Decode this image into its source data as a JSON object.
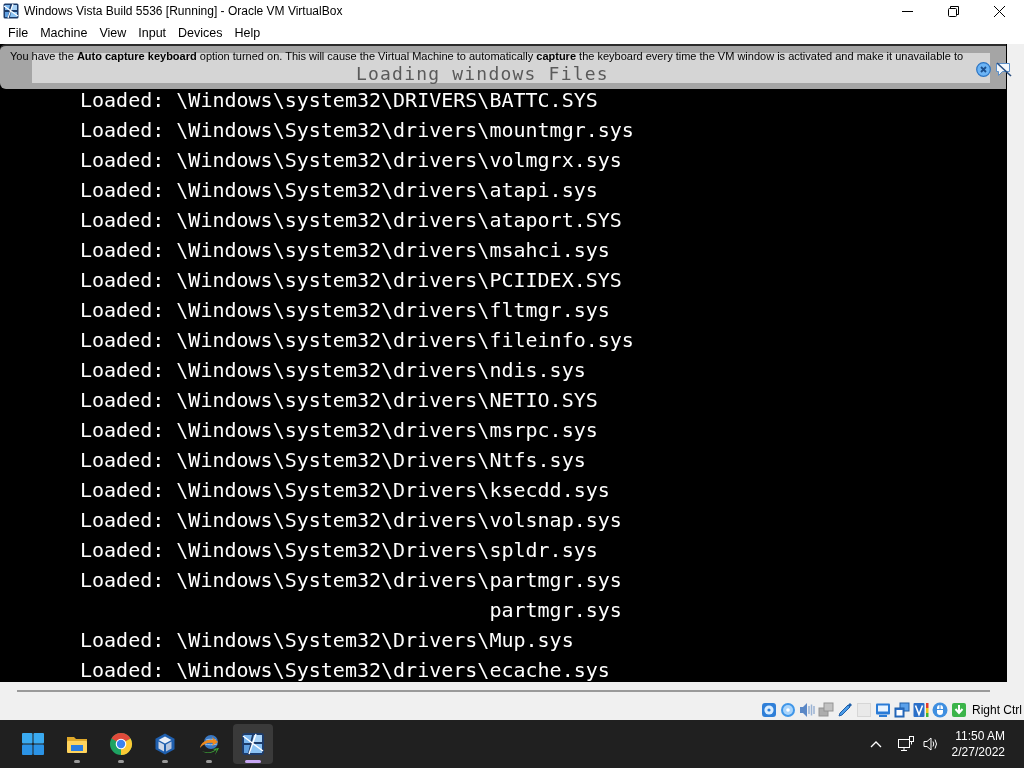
{
  "window": {
    "title": "Windows Vista Build 5536 [Running] - Oracle VM VirtualBox"
  },
  "menu": [
    "File",
    "Machine",
    "View",
    "Input",
    "Devices",
    "Help"
  ],
  "notification": {
    "text": "You have the **Auto capture keyboard** option turned on. This will cause the Virtual Machine to automatically **capture** the keyboard every time the VM window is activated and make it unavailable to"
  },
  "vm_screen": {
    "header": "Loading windows Files",
    "lines": [
      {
        "kind": "line",
        "text": "Loaded: \\Windows\\system32\\DRIVERS\\BATTC.SYS"
      },
      {
        "kind": "line",
        "text": "Loaded: \\Windows\\System32\\drivers\\mountmgr.sys"
      },
      {
        "kind": "line",
        "text": "Loaded: \\Windows\\System32\\drivers\\volmgrx.sys"
      },
      {
        "kind": "line",
        "text": "Loaded: \\Windows\\System32\\drivers\\atapi.sys"
      },
      {
        "kind": "line",
        "text": "Loaded: \\Windows\\system32\\drivers\\ataport.SYS"
      },
      {
        "kind": "line",
        "text": "Loaded: \\Windows\\system32\\drivers\\msahci.sys"
      },
      {
        "kind": "line",
        "text": "Loaded: \\Windows\\system32\\drivers\\PCIIDEX.SYS"
      },
      {
        "kind": "line",
        "text": "Loaded: \\Windows\\system32\\drivers\\fltmgr.sys"
      },
      {
        "kind": "line",
        "text": "Loaded: \\Windows\\system32\\drivers\\fileinfo.sys"
      },
      {
        "kind": "line",
        "text": "Loaded: \\Windows\\system32\\drivers\\ndis.sys"
      },
      {
        "kind": "line",
        "text": "Loaded: \\Windows\\system32\\drivers\\NETIO.SYS"
      },
      {
        "kind": "line",
        "text": "Loaded: \\Windows\\system32\\drivers\\msrpc.sys"
      },
      {
        "kind": "line",
        "text": "Loaded: \\Windows\\System32\\Drivers\\Ntfs.sys"
      },
      {
        "kind": "line",
        "text": "Loaded: \\Windows\\System32\\Drivers\\ksecdd.sys"
      },
      {
        "kind": "line",
        "text": "Loaded: \\Windows\\System32\\drivers\\volsnap.sys"
      },
      {
        "kind": "line",
        "text": "Loaded: \\Windows\\System32\\Drivers\\spldr.sys"
      },
      {
        "kind": "line",
        "text": "Loaded: \\Windows\\System32\\drivers\\partmgr.sys"
      },
      {
        "kind": "tail",
        "text": "partmgr.sys"
      },
      {
        "kind": "line",
        "text": "Loaded: \\Windows\\System32\\Drivers\\Mup.sys"
      },
      {
        "kind": "line",
        "text": "Loaded: \\Windows\\System32\\drivers\\ecache.sys"
      }
    ]
  },
  "status_bar": {
    "indicators": [
      {
        "kind": "hard-disk",
        "disabled": false
      },
      {
        "kind": "optical-disc",
        "disabled": false
      },
      {
        "kind": "audio",
        "disabled": false
      },
      {
        "kind": "network",
        "disabled": true
      },
      {
        "kind": "usb",
        "disabled": false
      },
      {
        "kind": "shared-folder",
        "disabled": true
      },
      {
        "kind": "display",
        "disabled": false
      },
      {
        "kind": "recording",
        "disabled": false
      },
      {
        "kind": "virtualization",
        "disabled": false
      },
      {
        "kind": "mouse",
        "disabled": false
      },
      {
        "kind": "keyboard-capture",
        "disabled": false
      }
    ],
    "host_key": "Right Ctrl"
  },
  "taskbar": {
    "apps": [
      {
        "kind": "folder",
        "selected": false
      },
      {
        "kind": "browser",
        "selected": false
      },
      {
        "kind": "cube",
        "selected": false
      },
      {
        "kind": "downloader",
        "selected": false
      },
      {
        "kind": "vista",
        "selected": true
      }
    ],
    "clock": {
      "time": "11:50 AM",
      "date": "2/27/2022"
    }
  }
}
